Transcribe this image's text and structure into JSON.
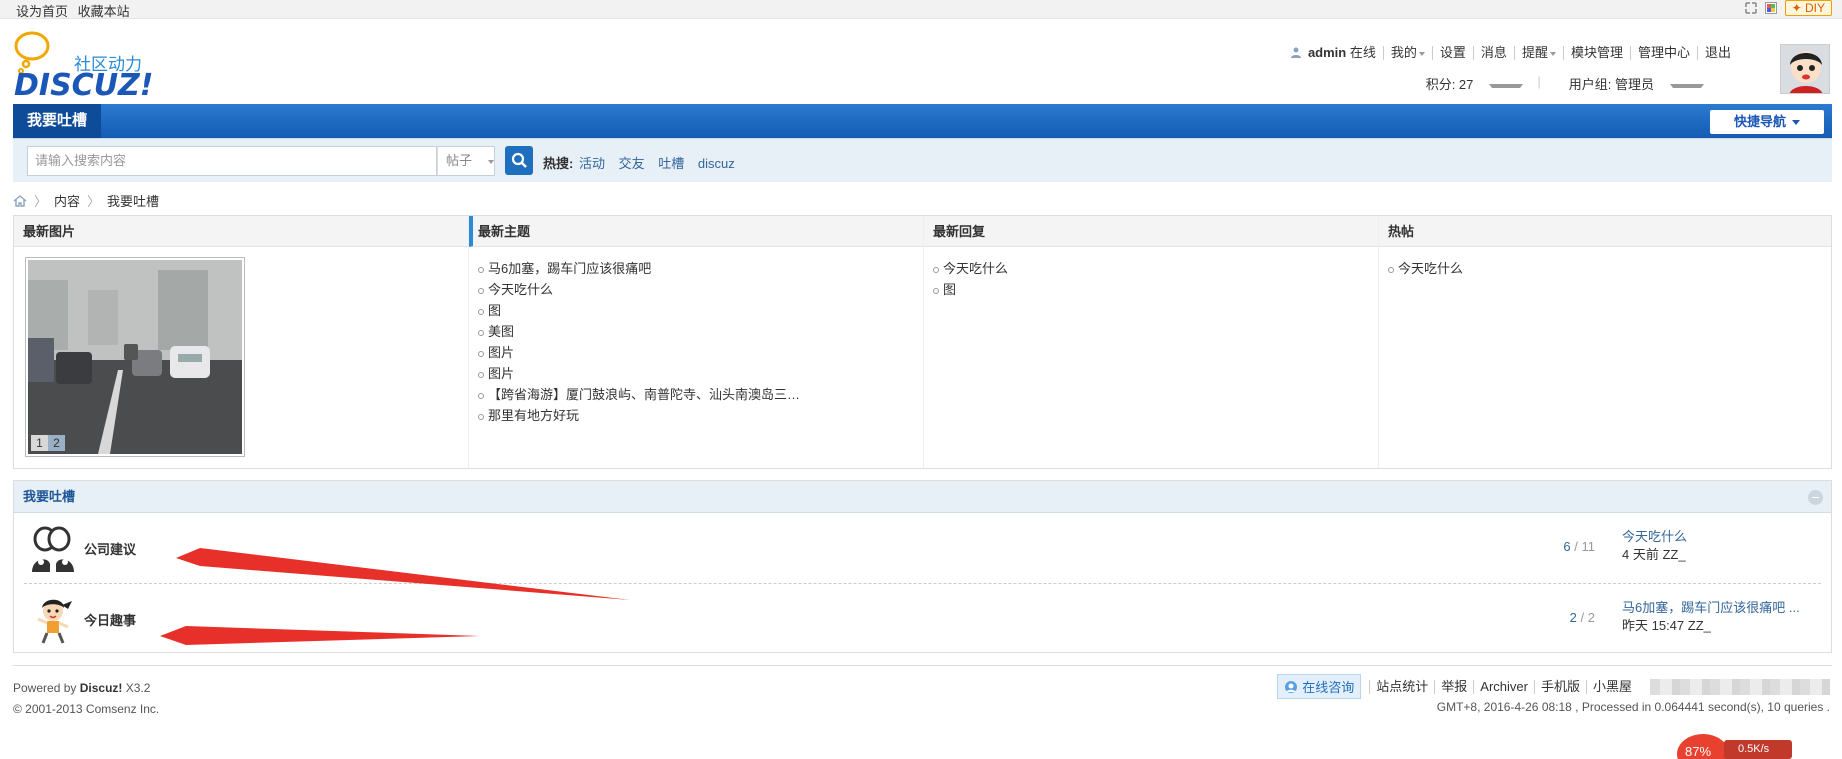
{
  "topbar": {
    "set_home": "设为首页",
    "bookmark": "收藏本站",
    "diy": "DIY"
  },
  "logo": {
    "main": "DISCUZ!",
    "sub": "社区动力"
  },
  "user": {
    "name": "admin",
    "status": "在线",
    "mine": "我的",
    "settings": "设置",
    "messages": "消息",
    "reminders": "提醒",
    "module_manage": "模块管理",
    "admin_center": "管理中心",
    "logout": "退出",
    "points": "积分: 27",
    "group": "用户组: 管理员"
  },
  "nav": {
    "active_tab": "我要吐槽",
    "quick_nav": "快捷导航"
  },
  "search": {
    "placeholder": "请输入搜索内容",
    "type": "帖子",
    "hot_label": "热搜:",
    "hot_terms": [
      "活动",
      "交友",
      "吐槽",
      "discuz"
    ]
  },
  "breadcrumb": [
    "内容",
    "我要吐槽"
  ],
  "latest": {
    "columns": {
      "pics": "最新图片",
      "topics": "最新主题",
      "replies": "最新回复",
      "hot": "热帖"
    },
    "pic_pages": [
      "1",
      "2"
    ],
    "topics": [
      "马6加塞，踢车门应该很痛吧",
      "今天吃什么",
      "图",
      "美图",
      "图片",
      "图片",
      "【跨省海游】厦门鼓浪屿、南普陀寺、汕头南澳岛三天（...",
      "那里有地方好玩"
    ],
    "replies": [
      "今天吃什么",
      "图"
    ],
    "hot": [
      "今天吃什么"
    ]
  },
  "forum": {
    "title": "我要吐槽",
    "rows": [
      {
        "name": "公司建议",
        "threads": "6",
        "posts": "11",
        "last_title": "今天吃什么",
        "last_meta": "4 天前 ZZ_"
      },
      {
        "name": "今日趣事",
        "threads": "2",
        "posts": "2",
        "last_title": "马6加塞，踢车门应该很痛吧 ...",
        "last_meta": "昨天 15:47 ZZ_"
      }
    ]
  },
  "footer": {
    "powered_prefix": "Powered by",
    "powered_brand": "Discuz!",
    "powered_version": "X3.2",
    "copyright": "© 2001-2013 Comsenz Inc.",
    "consult": "在线咨询",
    "links": [
      "站点统计",
      "举报",
      "Archiver",
      "手机版",
      "小黑屋"
    ],
    "gmt": "GMT+8, 2016-4-26 08:18 , Processed in 0.064441 second(s), 10 queries ."
  },
  "speed_widget": {
    "percent": "87%",
    "speed": "0.5K/s"
  },
  "colors": {
    "nav_blue": "#1b65c0",
    "link_blue": "#336699",
    "arrow_red": "#e8302a"
  }
}
